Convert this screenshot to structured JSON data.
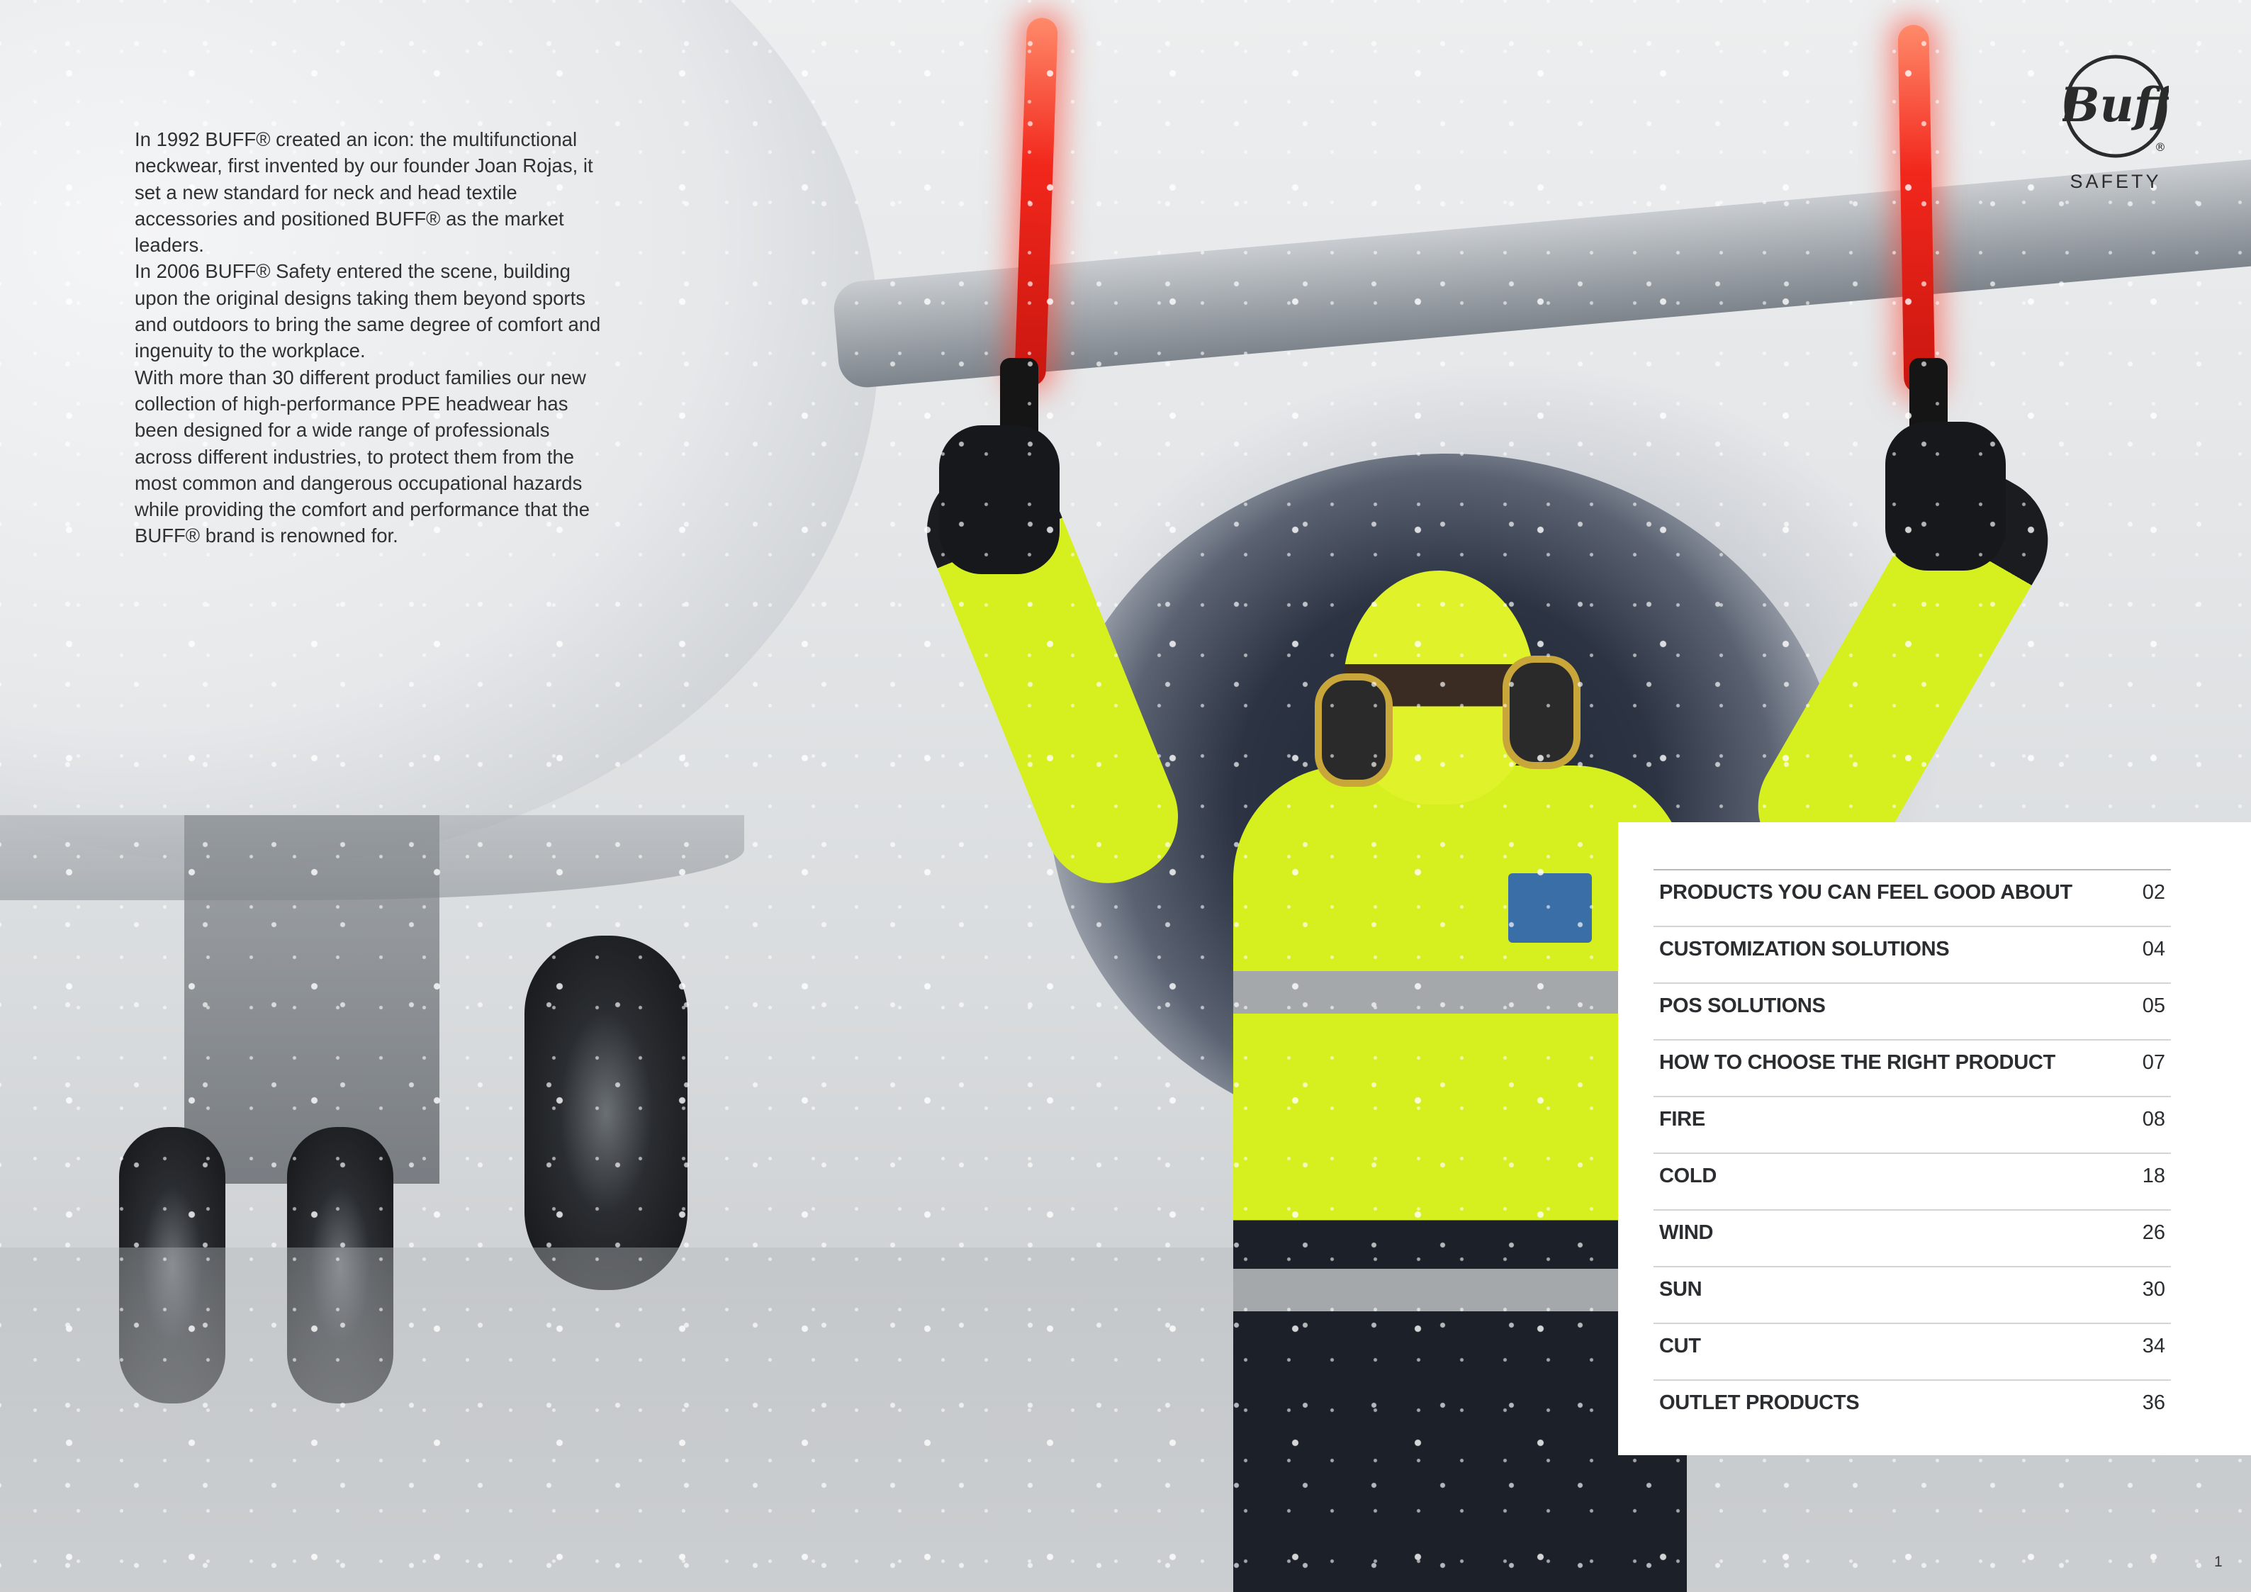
{
  "intro": {
    "paragraphs": [
      "In 1992 BUFF® created an icon: the multifunctional neckwear, first invented by our founder Joan Rojas, it set a new standard for neck and head textile accessories and positioned BUFF® as the market leaders.",
      "In 2006 BUFF® Safety entered the scene, building upon the original designs taking them beyond sports and outdoors to bring the same degree of comfort and ingenuity to the workplace.",
      "With more than 30 different product families our new collection of high-performance PPE headwear has been designed for a wide range of professionals across different industries, to protect them from the most common and dangerous occupational hazards while providing the comfort and performance that the BUFF® brand is renowned for."
    ]
  },
  "logo": {
    "brand": "Buff",
    "registered": "®",
    "subline": "SAFETY"
  },
  "toc": {
    "items": [
      {
        "label": "PRODUCTS YOU CAN FEEL GOOD ABOUT",
        "page": "02"
      },
      {
        "label": "CUSTOMIZATION SOLUTIONS",
        "page": "04"
      },
      {
        "label": "POS SOLUTIONS",
        "page": "05"
      },
      {
        "label": "HOW TO CHOOSE THE RIGHT PRODUCT",
        "page": "07"
      },
      {
        "label": "FIRE",
        "page": "08"
      },
      {
        "label": "COLD",
        "page": "18"
      },
      {
        "label": "WIND",
        "page": "26"
      },
      {
        "label": "SUN",
        "page": "30"
      },
      {
        "label": "CUT",
        "page": "34"
      },
      {
        "label": "OUTLET PRODUCTS",
        "page": "36"
      }
    ]
  },
  "page_number": "1",
  "colors": {
    "hi_vis_yellow": "#d6ef1f",
    "wand_red": "#f2271c",
    "panel_white": "#ffffff",
    "text_dark": "#2b2d30"
  }
}
